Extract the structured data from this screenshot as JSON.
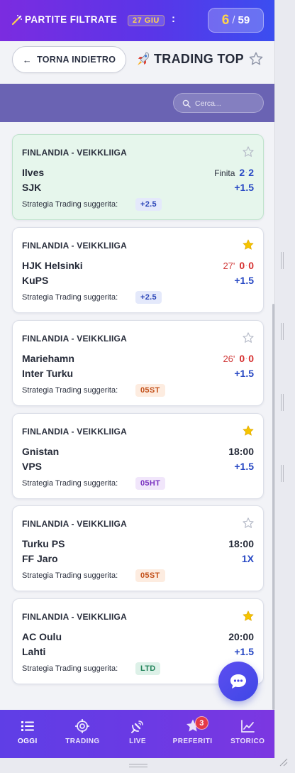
{
  "header": {
    "wand_icon": "magic-wand-icon",
    "title": "PARTITE FILTRATE",
    "date": "27 GIU",
    "colon": ":",
    "counter_current": "6",
    "counter_sep": "/",
    "counter_total": "59"
  },
  "nav": {
    "back_label": "TORNA INDIETRO",
    "back_arrow": "←",
    "page_title": "TRADING TOP",
    "title_icon": "rocket-icon"
  },
  "search": {
    "placeholder": "Cerca..."
  },
  "strategy_label": "Strategia Trading suggerita:",
  "matches": [
    {
      "league": "FINLANDIA - VEIKKLIIGA",
      "home": "Ilves",
      "away": "SJK",
      "status": "Finita",
      "score_home": "2",
      "score_away": "2",
      "odds": "+1.5",
      "strategy": "+2.5",
      "favorite": false
    },
    {
      "league": "FINLANDIA - VEIKKLIIGA",
      "home": "HJK Helsinki",
      "away": "KuPS",
      "minute": "27'",
      "score_home": "0",
      "score_away": "0",
      "odds": "+1.5",
      "strategy": "+2.5",
      "favorite": true
    },
    {
      "league": "FINLANDIA - VEIKKLIIGA",
      "home": "Mariehamn",
      "away": "Inter Turku",
      "minute": "26'",
      "score_home": "0",
      "score_away": "0",
      "odds": "+1.5",
      "strategy": "05ST",
      "favorite": false
    },
    {
      "league": "FINLANDIA - VEIKKLIIGA",
      "home": "Gnistan",
      "away": "VPS",
      "time": "18:00",
      "odds": "+1.5",
      "strategy": "05HT",
      "favorite": true
    },
    {
      "league": "FINLANDIA - VEIKKLIIGA",
      "home": "Turku PS",
      "away": "FF Jaro",
      "time": "18:00",
      "odds": "1X",
      "strategy": "05ST",
      "favorite": false
    },
    {
      "league": "FINLANDIA - VEIKKLIIGA",
      "home": "AC Oulu",
      "away": "Lahti",
      "time": "20:00",
      "odds": "+1.5",
      "strategy": "LTD",
      "favorite": true
    }
  ],
  "colors": {
    "header_gradient_start": "#7b2ce0",
    "header_gradient_end": "#3b4ef0",
    "band": "#6a63b3",
    "accent_blue": "#2748c4",
    "live_red": "#d63030",
    "favorite_star": "#f5c400",
    "badge_red": "#e53946"
  },
  "bottom_nav": [
    {
      "label": "OGGI",
      "icon": "list-icon",
      "active": true
    },
    {
      "label": "TRADING",
      "icon": "target-icon",
      "active": false
    },
    {
      "label": "LIVE",
      "icon": "satellite-icon",
      "active": false
    },
    {
      "label": "PREFERITI",
      "icon": "star-icon",
      "active": false,
      "badge": "3"
    },
    {
      "label": "STORICO",
      "icon": "chart-line-icon",
      "active": false
    }
  ],
  "chat_icon": "chat-bubble-icon"
}
